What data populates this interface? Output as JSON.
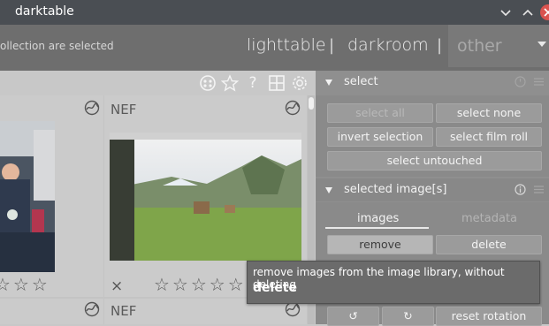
{
  "window": {
    "title": "darktable",
    "minimize_icon": "chevron-down-icon",
    "maximize_icon": "chevron-up-icon",
    "close_icon": "close-icon"
  },
  "header": {
    "status": "ollection are selected",
    "views": [
      "lighttable",
      "darkroom",
      "other"
    ],
    "separator": "|"
  },
  "toolbar": {
    "icons": [
      "color-labels-icon",
      "star-icon",
      "help-icon",
      "layout-grid-icon",
      "gear-icon"
    ]
  },
  "grid": {
    "cells": [
      {
        "label": "",
        "stars": "☆☆☆",
        "reject": ""
      },
      {
        "label": "NEF",
        "stars": "☆☆☆☆☆",
        "reject": "×"
      },
      {
        "label": "",
        "stars": "",
        "reject": ""
      },
      {
        "label": "NEF",
        "stars": "",
        "reject": ""
      }
    ]
  },
  "panel": {
    "select": {
      "title": "select",
      "buttons": {
        "select_all": "select all",
        "select_none": "select none",
        "invert": "invert selection",
        "film_roll": "select film roll",
        "untouched": "select untouched"
      }
    },
    "selected": {
      "title": "selected image[s]",
      "tabs": [
        "images",
        "metadata"
      ],
      "buttons": {
        "remove": "remove",
        "delete": "delete",
        "rotate_ccw": "↺",
        "rotate_cw": "↻",
        "reset_rotation": "reset rotation"
      }
    }
  },
  "tooltip": {
    "text": "remove images from the image library, without deleting",
    "key": "delete"
  },
  "colors": {
    "titlebar": "#4a4e53",
    "header": "#6e6e6e",
    "panel": "#8f8f8f",
    "close": "#d9534f"
  }
}
